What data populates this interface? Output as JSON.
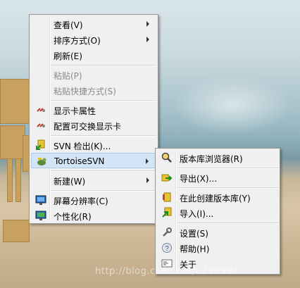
{
  "main_menu": {
    "items": [
      {
        "label": "查看(V)"
      },
      {
        "label": "排序方式(O)"
      },
      {
        "label": "刷新(E)"
      },
      {
        "label": "粘贴(P)"
      },
      {
        "label": "粘贴快捷方式(S)"
      },
      {
        "label": "显示卡属性"
      },
      {
        "label": "配置可交换显示卡"
      },
      {
        "label": "SVN 检出(K)..."
      },
      {
        "label": "TortoiseSVN"
      },
      {
        "label": "新建(W)"
      },
      {
        "label": "屏幕分辨率(C)"
      },
      {
        "label": "个性化(R)"
      }
    ]
  },
  "svn_submenu": {
    "items": [
      {
        "label": "版本库浏览器(R)"
      },
      {
        "label": "导出(X)..."
      },
      {
        "label": "在此创建版本库(Y)"
      },
      {
        "label": "导入(I)..."
      },
      {
        "label": "设置(S)"
      },
      {
        "label": "帮助(H)"
      },
      {
        "label": "关于"
      }
    ]
  },
  "watermark": {
    "text": "http://blog.csdn.net/u290994"
  },
  "colors": {
    "menu_bg": "#f0f0f0",
    "highlight": "#d3e4f6",
    "highlight_border": "#a8cbef"
  }
}
